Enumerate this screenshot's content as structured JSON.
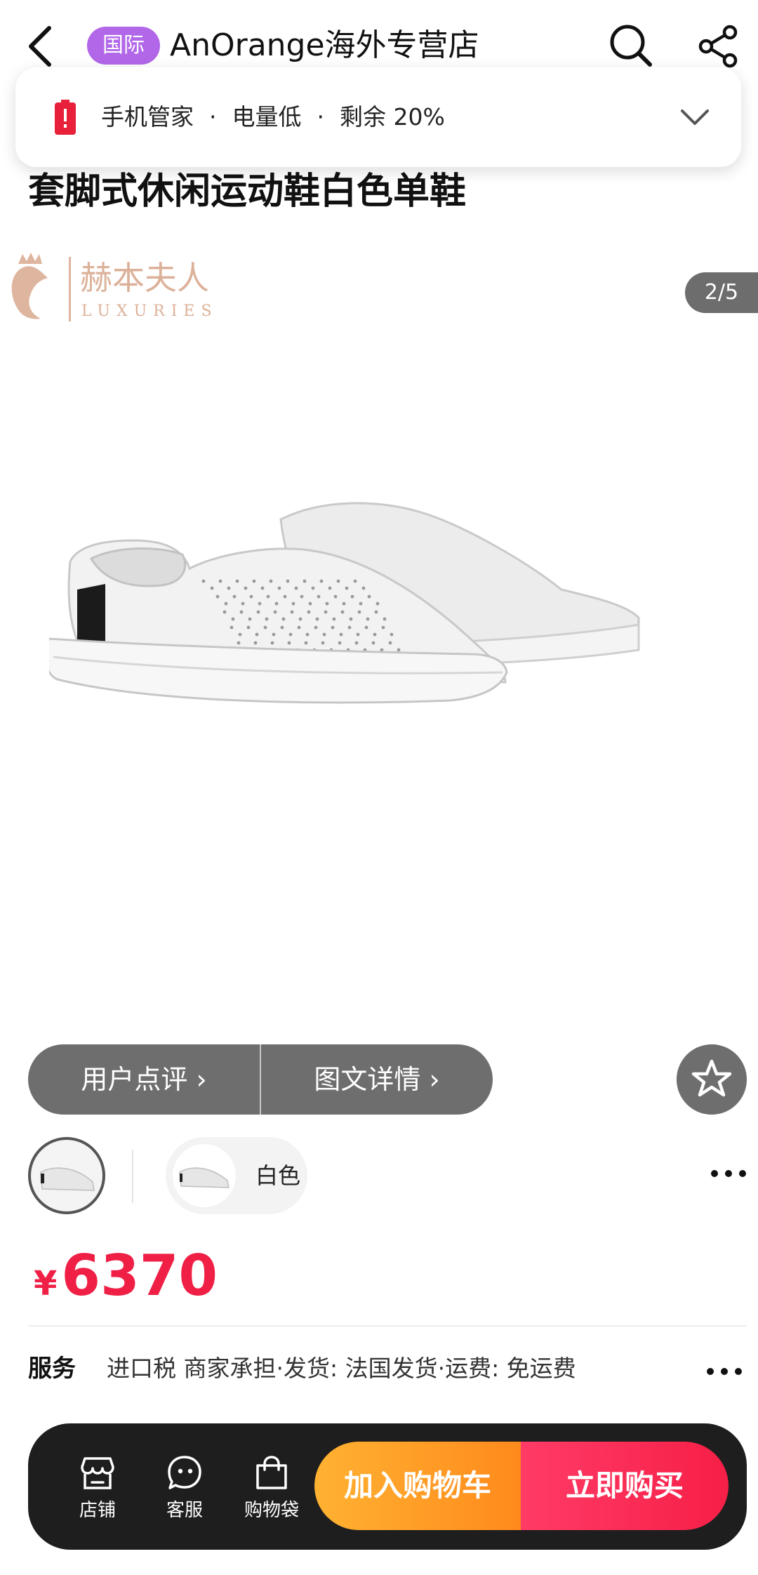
{
  "header": {
    "badge": "国际",
    "store_name": "AnOrange海外专营店"
  },
  "notification": {
    "app": "手机管家",
    "message": "电量低",
    "remaining": "剩余 20%",
    "separator": "·",
    "accent_color": "#e8203a"
  },
  "product": {
    "title": "套脚式休闲运动鞋白色单鞋",
    "watermark_text": "赫本夫人",
    "watermark_sub": "LUXURIES",
    "pager": "2/5"
  },
  "tabs": {
    "reviews": "用户点评",
    "details": "图文详情"
  },
  "variants": {
    "selected_label": "白色"
  },
  "price": {
    "currency": "¥",
    "value": "6370",
    "color": "#ef1f45"
  },
  "service": {
    "label": "服务",
    "text": "进口税 商家承担·发货: 法国发货·运费: 免运费"
  },
  "bottom_bar": {
    "store": "店铺",
    "service": "客服",
    "bag": "购物袋",
    "add_to_cart": "加入购物车",
    "buy_now": "立即购买"
  }
}
